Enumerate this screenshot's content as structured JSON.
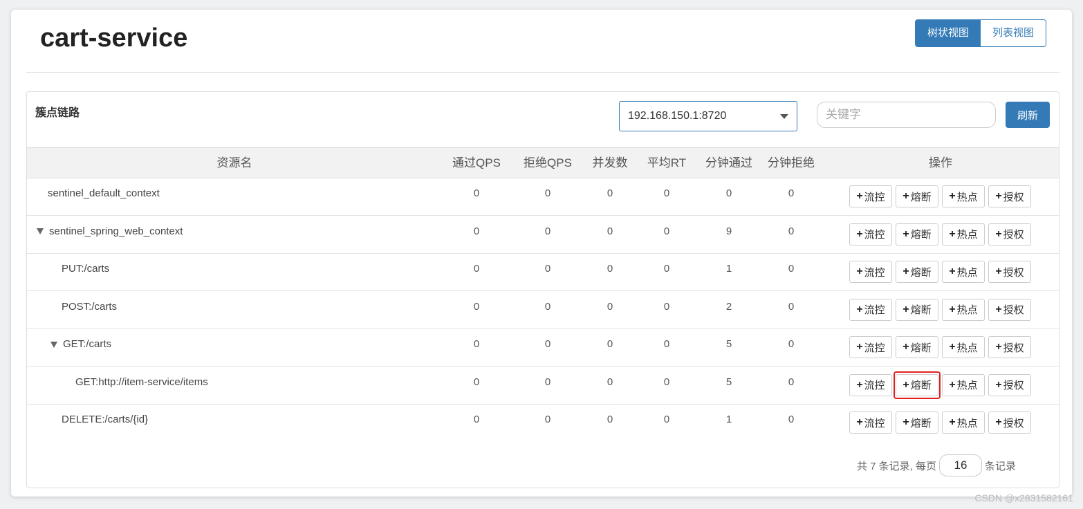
{
  "header": {
    "title": "cart-service"
  },
  "view_toggle": {
    "tree_label": "树状视图",
    "list_label": "列表视图",
    "active": "tree"
  },
  "panel": {
    "title": "簇点链路",
    "machine_select": {
      "value": "192.168.150.1:8720"
    },
    "search": {
      "placeholder": "关键字",
      "value": ""
    },
    "refresh_label": "刷新"
  },
  "table": {
    "columns": [
      "资源名",
      "通过QPS",
      "拒绝QPS",
      "并发数",
      "平均RT",
      "分钟通过",
      "分钟拒绝",
      "操作"
    ],
    "op_labels": {
      "flow": "流控",
      "degrade": "熔断",
      "hotspot": "热点",
      "authority": "授权"
    },
    "rows": [
      {
        "name": "sentinel_default_context",
        "depth": 0,
        "expandable": false,
        "pass_qps": "0",
        "block_qps": "0",
        "concurrency": "0",
        "avg_rt": "0",
        "minute_pass": "0",
        "minute_block": "0"
      },
      {
        "name": "sentinel_spring_web_context",
        "depth": 0,
        "expandable": true,
        "pass_qps": "0",
        "block_qps": "0",
        "concurrency": "0",
        "avg_rt": "0",
        "minute_pass": "9",
        "minute_block": "0"
      },
      {
        "name": "PUT:/carts",
        "depth": 1,
        "expandable": false,
        "pass_qps": "0",
        "block_qps": "0",
        "concurrency": "0",
        "avg_rt": "0",
        "minute_pass": "1",
        "minute_block": "0"
      },
      {
        "name": "POST:/carts",
        "depth": 1,
        "expandable": false,
        "pass_qps": "0",
        "block_qps": "0",
        "concurrency": "0",
        "avg_rt": "0",
        "minute_pass": "2",
        "minute_block": "0"
      },
      {
        "name": "GET:/carts",
        "depth": 1,
        "expandable": true,
        "pass_qps": "0",
        "block_qps": "0",
        "concurrency": "0",
        "avg_rt": "0",
        "minute_pass": "5",
        "minute_block": "0"
      },
      {
        "name": "GET:http://item-service/items",
        "depth": 2,
        "expandable": false,
        "pass_qps": "0",
        "block_qps": "0",
        "concurrency": "0",
        "avg_rt": "0",
        "minute_pass": "5",
        "minute_block": "0",
        "highlight_op": "degrade"
      },
      {
        "name": "DELETE:/carts/{id}",
        "depth": 1,
        "expandable": false,
        "pass_qps": "0",
        "block_qps": "0",
        "concurrency": "0",
        "avg_rt": "0",
        "minute_pass": "1",
        "minute_block": "0"
      }
    ]
  },
  "pagination": {
    "summary": "共 7 条记录, 每页",
    "page_size": "16",
    "suffix": "条记录"
  },
  "watermark": "CSDN @x2831582161",
  "colors": {
    "primary": "#337ab7",
    "highlight": "#e02020"
  }
}
